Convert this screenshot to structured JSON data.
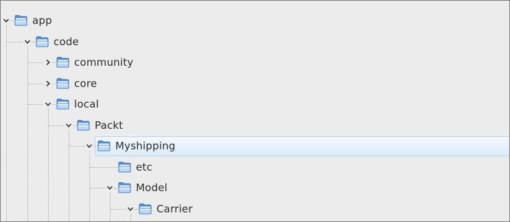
{
  "tree": {
    "nodes": [
      {
        "label": "app",
        "level": 0,
        "state": "expanded"
      },
      {
        "label": "code",
        "level": 1,
        "state": "expanded"
      },
      {
        "label": "community",
        "level": 2,
        "state": "collapsed"
      },
      {
        "label": "core",
        "level": 2,
        "state": "collapsed"
      },
      {
        "label": "local",
        "level": 2,
        "state": "expanded"
      },
      {
        "label": "Packt",
        "level": 3,
        "state": "expanded"
      },
      {
        "label": "Myshipping",
        "level": 4,
        "state": "expanded",
        "selected": true
      },
      {
        "label": "etc",
        "level": 5,
        "state": "leaf"
      },
      {
        "label": "Model",
        "level": 5,
        "state": "expanded"
      },
      {
        "label": "Carrier",
        "level": 6,
        "state": "expanded"
      }
    ]
  },
  "colors": {
    "folder_body": "#4f8fd6",
    "folder_light": "#bcd9f7",
    "selection": "#dcebfa",
    "background": "#ececec"
  },
  "icons": {
    "expanded": "chevron-down-icon",
    "collapsed": "chevron-right-icon",
    "folder": "folder-icon"
  }
}
